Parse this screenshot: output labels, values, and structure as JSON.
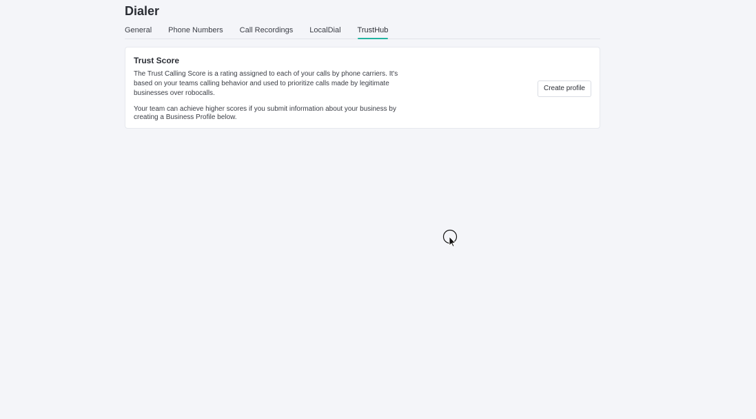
{
  "header": {
    "title": "Dialer"
  },
  "tabs": [
    {
      "label": "General"
    },
    {
      "label": "Phone Numbers"
    },
    {
      "label": "Call Recordings"
    },
    {
      "label": "LocalDial"
    },
    {
      "label": "TrustHub",
      "active": true
    }
  ],
  "trust_score": {
    "title": "Trust Score",
    "paragraph_1": "The Trust Calling Score is a rating assigned to each of your calls by phone carriers. It's based on your teams calling behavior and used to prioritize calls made by legitimate businesses over robocalls.",
    "paragraph_2": "Your team can achieve higher scores if you submit information about your business by creating a Business Profile below.",
    "create_button_label": "Create profile"
  },
  "colors": {
    "accent": "#21b3a0",
    "background": "#f4f5f9"
  },
  "cursor": {
    "icon": "mouse-pointer-icon"
  }
}
